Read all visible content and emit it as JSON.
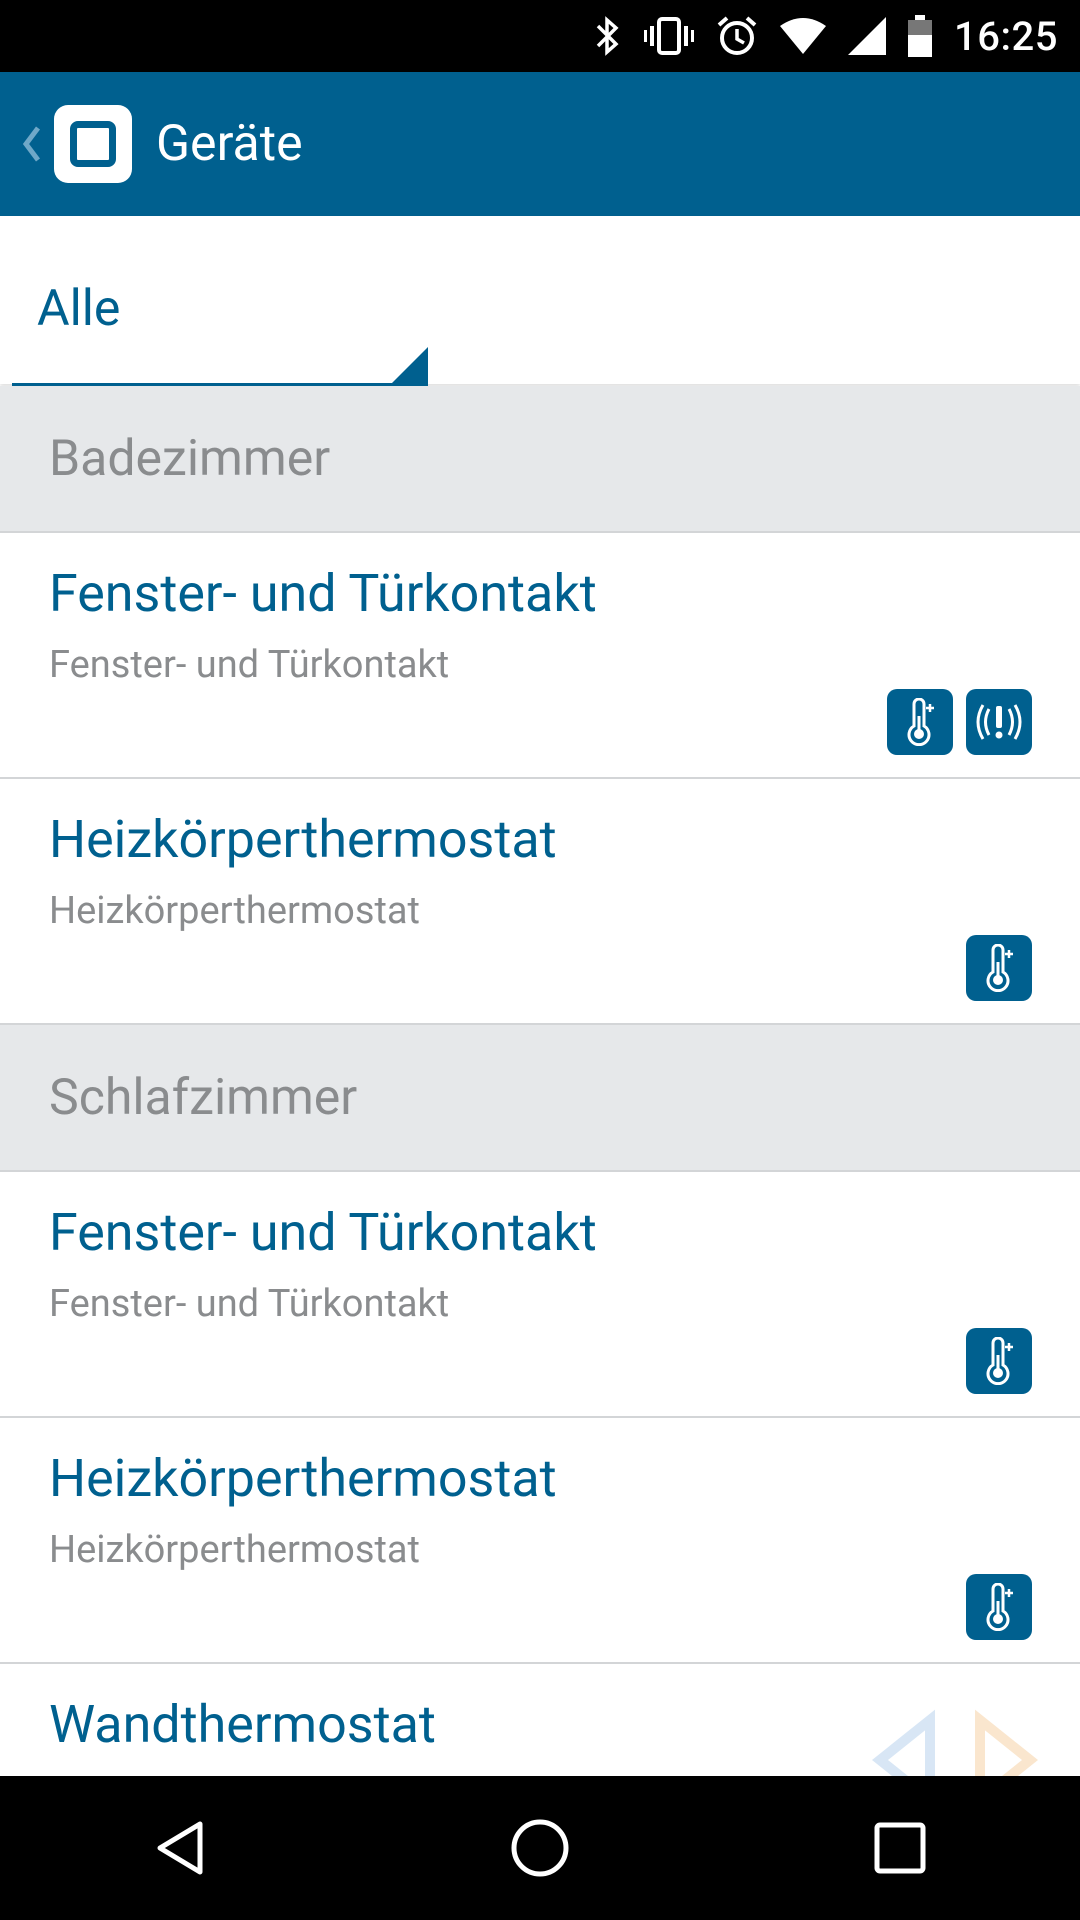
{
  "status_bar": {
    "time": "16:25",
    "icons": [
      "bluetooth-icon",
      "vibrate-icon",
      "alarm-icon",
      "wifi-icon",
      "signal-icon",
      "battery-icon"
    ]
  },
  "app_bar": {
    "title": "Geräte",
    "color": "#00608f"
  },
  "filter": {
    "selected": "Alle"
  },
  "sections": [
    {
      "title": "Badezimmer",
      "devices": [
        {
          "name": "Fenster- und Türkontakt",
          "type": "Fenster- und Türkontakt",
          "badges": [
            "thermometer-icon",
            "alert-icon"
          ]
        },
        {
          "name": "Heizkörperthermostat",
          "type": "Heizkörperthermostat",
          "badges": [
            "thermometer-icon"
          ]
        }
      ]
    },
    {
      "title": "Schlafzimmer",
      "devices": [
        {
          "name": "Fenster- und Türkontakt",
          "type": "Fenster- und Türkontakt",
          "badges": [
            "thermometer-icon"
          ]
        },
        {
          "name": "Heizkörperthermostat",
          "type": "Heizkörperthermostat",
          "badges": [
            "thermometer-icon"
          ]
        },
        {
          "name": "Wandthermostat",
          "type": "",
          "badges": []
        }
      ]
    }
  ],
  "nav_bar": [
    "back-nav-icon",
    "home-nav-icon",
    "recents-nav-icon"
  ]
}
